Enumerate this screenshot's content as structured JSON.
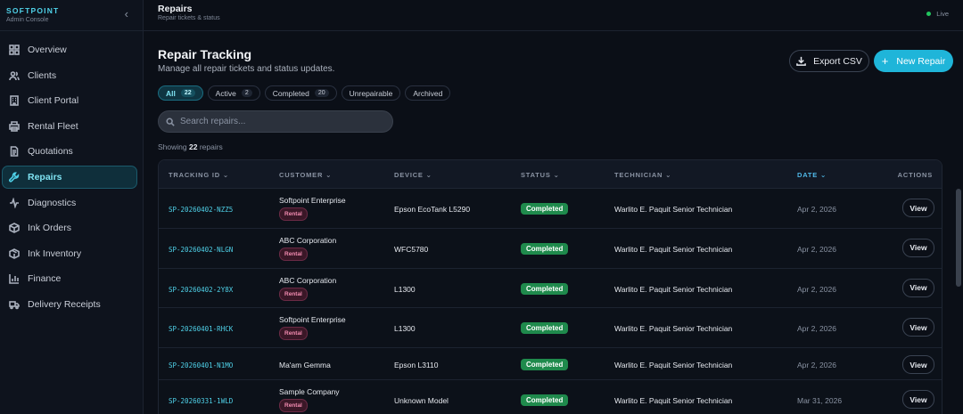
{
  "brand": {
    "name": "SOFTPOINT",
    "subtitle": "Admin Console"
  },
  "sidebar": {
    "items": [
      {
        "label": "Overview",
        "icon": "grid-icon"
      },
      {
        "label": "Clients",
        "icon": "users-icon"
      },
      {
        "label": "Client Portal",
        "icon": "building-icon"
      },
      {
        "label": "Rental Fleet",
        "icon": "printer-icon"
      },
      {
        "label": "Quotations",
        "icon": "document-icon"
      },
      {
        "label": "Repairs",
        "icon": "wrench-icon",
        "active": true
      },
      {
        "label": "Diagnostics",
        "icon": "activity-icon"
      },
      {
        "label": "Ink Orders",
        "icon": "box-icon"
      },
      {
        "label": "Ink Inventory",
        "icon": "package-icon"
      },
      {
        "label": "Finance",
        "icon": "bar-chart-icon"
      },
      {
        "label": "Delivery Receipts",
        "icon": "truck-icon"
      }
    ]
  },
  "topbar": {
    "title": "Repairs",
    "subtitle": "Repair tickets & status",
    "status": "Live"
  },
  "page": {
    "title": "Repair Tracking",
    "subtitle": "Manage all repair tickets and status updates.",
    "export_label": "Export CSV",
    "new_label": "New Repair"
  },
  "filters": [
    {
      "label": "All",
      "count": "22",
      "active": true
    },
    {
      "label": "Active",
      "count": "2"
    },
    {
      "label": "Completed",
      "count": "20"
    },
    {
      "label": "Unrepairable"
    },
    {
      "label": "Archived"
    }
  ],
  "search": {
    "placeholder": "Search repairs..."
  },
  "showing": {
    "prefix": "Showing",
    "count": "22",
    "suffix": "repairs"
  },
  "table": {
    "headers": {
      "tracking": "TRACKING ID",
      "customer": "CUSTOMER",
      "device": "DEVICE",
      "status": "STATUS",
      "technician": "TECHNICIAN",
      "date": "DATE",
      "actions": "ACTIONS"
    },
    "rows": [
      {
        "id": "SP-20260402-NZZ5",
        "customer": "Softpoint Enterprise",
        "tag": "Rental",
        "device": "Epson EcoTank L5290",
        "status": "Completed",
        "technician": "Warlito E. Paquit Senior Technician",
        "date": "Apr 2, 2026",
        "action": "View"
      },
      {
        "id": "SP-20260402-NLGN",
        "customer": "ABC Corporation",
        "tag": "Rental",
        "device": "WFC5780",
        "status": "Completed",
        "technician": "Warlito E. Paquit Senior Technician",
        "date": "Apr 2, 2026",
        "action": "View"
      },
      {
        "id": "SP-20260402-2Y8X",
        "customer": "ABC Corporation",
        "tag": "Rental",
        "device": "L1300",
        "status": "Completed",
        "technician": "Warlito E. Paquit Senior Technician",
        "date": "Apr 2, 2026",
        "action": "View"
      },
      {
        "id": "SP-20260401-RHCK",
        "customer": "Softpoint Enterprise",
        "tag": "Rental",
        "device": "L1300",
        "status": "Completed",
        "technician": "Warlito E. Paquit Senior Technician",
        "date": "Apr 2, 2026",
        "action": "View"
      },
      {
        "id": "SP-20260401-N1MO",
        "customer": "Ma'am Gemma",
        "tag": "",
        "device": "Epson L3110",
        "status": "Completed",
        "technician": "Warlito E. Paquit Senior Technician",
        "date": "Apr 2, 2026",
        "action": "View"
      },
      {
        "id": "SP-20260331-1WLD",
        "customer": "Sample Company",
        "tag": "Rental",
        "device": "Unknown Model",
        "status": "Completed",
        "technician": "Warlito E. Paquit Senior Technician",
        "date": "Mar 31, 2026",
        "action": "View"
      }
    ]
  },
  "colors": {
    "accent": "#1fb5d9",
    "status_completed": "#1f8a4c",
    "rental_tag": "#f28bb0"
  }
}
